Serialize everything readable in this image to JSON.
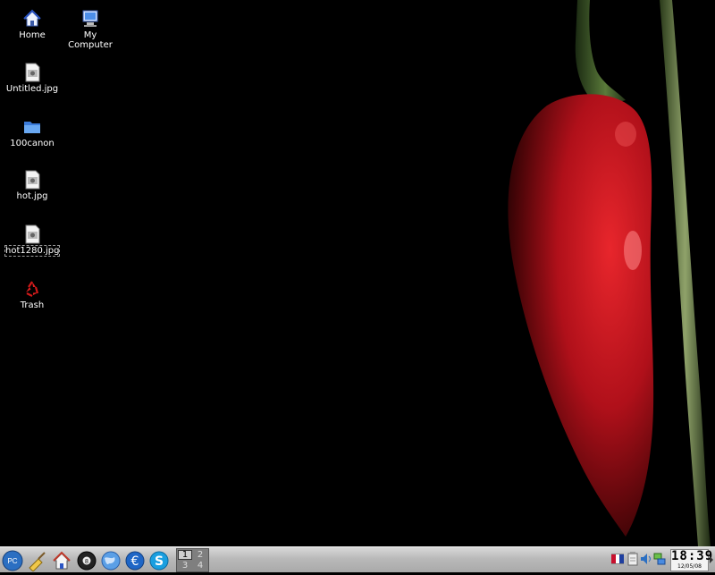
{
  "desktop": {
    "icons": [
      {
        "label": "Home",
        "icon": "home-folder-icon"
      },
      {
        "label": "My Computer",
        "icon": "computer-icon"
      },
      {
        "label": "Untitled.jpg",
        "icon": "image-file-icon"
      },
      {
        "label": "100canon",
        "icon": "folder-icon"
      },
      {
        "label": "hot.jpg",
        "icon": "image-file-icon"
      },
      {
        "label": "hot1280.jpg",
        "icon": "image-file-icon",
        "selected": true
      },
      {
        "label": "Trash",
        "icon": "trash-icon"
      }
    ],
    "wallpaper": "red chili pepper on black background"
  },
  "taskbar": {
    "start_label": "PC",
    "launchers": [
      "broom-icon",
      "home-icon",
      "ball-icon",
      "globe-icon",
      "euro-icon",
      "skype-icon"
    ],
    "pager": [
      "1",
      "2",
      "3",
      "4"
    ],
    "active_desktop": "1",
    "tray_icons": [
      "keyboard-layout-icon",
      "clipboard-icon",
      "volume-icon",
      "network-icon"
    ],
    "clock": {
      "time": "18:39",
      "date": "12/05/08"
    }
  },
  "colors": {
    "taskbar": "#b9b9b9",
    "pepper": "#b0101a",
    "stem": "#3d5a28"
  }
}
